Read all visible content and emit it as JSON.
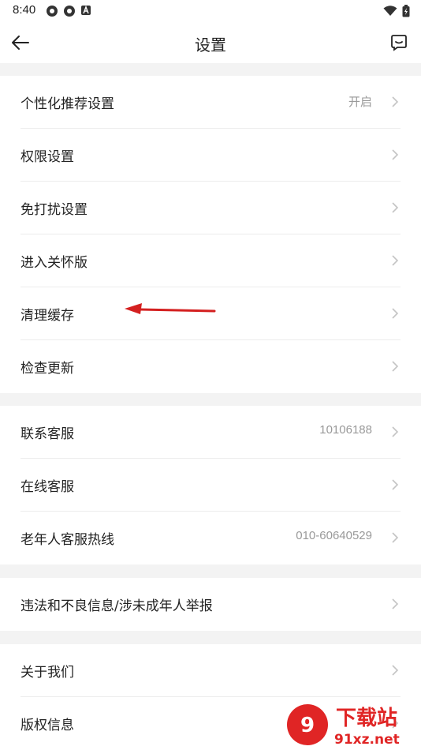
{
  "status": {
    "time": "8:40"
  },
  "appbar": {
    "title": "设置"
  },
  "groups": [
    {
      "rows": [
        {
          "label": "个性化推荐设置",
          "value": "开启"
        },
        {
          "label": "权限设置",
          "value": ""
        },
        {
          "label": "免打扰设置",
          "value": ""
        },
        {
          "label": "进入关怀版",
          "value": ""
        },
        {
          "label": "清理缓存",
          "value": ""
        },
        {
          "label": "检查更新",
          "value": ""
        }
      ]
    },
    {
      "rows": [
        {
          "label": "联系客服",
          "value": "10106188"
        },
        {
          "label": "在线客服",
          "value": ""
        },
        {
          "label": "老年人客服热线",
          "value": "010-60640529"
        }
      ]
    },
    {
      "rows": [
        {
          "label": "违法和不良信息/涉未成年人举报",
          "value": ""
        }
      ]
    },
    {
      "rows": [
        {
          "label": "关于我们",
          "value": ""
        },
        {
          "label": "版权信息",
          "value": ""
        }
      ]
    }
  ],
  "watermark": {
    "brand": "下载站",
    "domain": "91xz.net"
  },
  "colors": {
    "accent_annotation": "#d42020",
    "text": "#222222",
    "muted": "#999999",
    "divider": "#ececec",
    "background": "#f3f3f3"
  }
}
